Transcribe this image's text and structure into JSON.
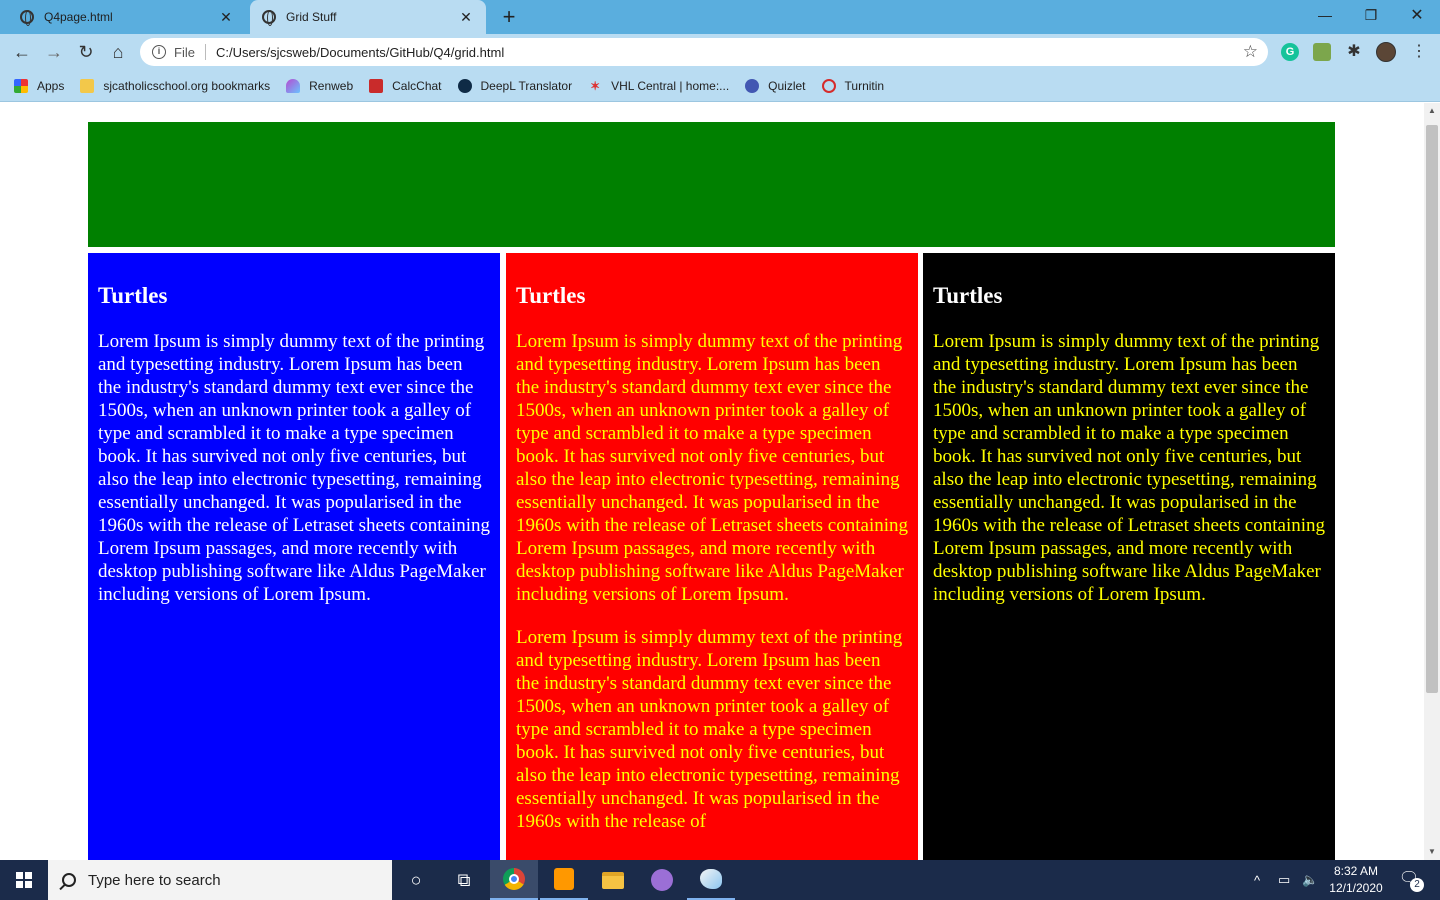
{
  "browser": {
    "tabs": [
      {
        "title": "Q4page.html",
        "close": "✕"
      },
      {
        "title": "Grid Stuff",
        "close": "✕"
      }
    ],
    "new_tab": "+",
    "window_controls": {
      "minimize": "—",
      "maximize": "❐",
      "close": "✕"
    },
    "nav": {
      "back": "←",
      "forward": "→",
      "reload": "↻",
      "home": "⌂"
    },
    "omnibox": {
      "info": "i",
      "scheme": "File",
      "url": "C:/Users/sjcsweb/Documents/GitHub/Q4/grid.html",
      "star": "☆"
    },
    "extensions": {
      "grammarly": "G",
      "puzzle": "✱",
      "menu": "⋮"
    }
  },
  "bookmarks": [
    {
      "label": "Apps",
      "icon": "apps-grid-icon"
    },
    {
      "label": "sjcatholicschool.org bookmarks",
      "icon": "folder-icon"
    },
    {
      "label": "Renweb",
      "icon": "renweb-icon"
    },
    {
      "label": "CalcChat",
      "icon": "calcchat-icon"
    },
    {
      "label": "DeepL Translator",
      "icon": "deepl-icon"
    },
    {
      "label": "VHL Central | home:...",
      "icon": "vhl-icon",
      "glyph": "✶"
    },
    {
      "label": "Quizlet",
      "icon": "quizlet-icon"
    },
    {
      "label": "Turnitin",
      "icon": "turnitin-icon"
    }
  ],
  "page": {
    "colors": {
      "header": "#008000",
      "col1": "#0000ff",
      "col2": "#ff0000",
      "col3": "#000000",
      "yellow_text": "#ffff00"
    },
    "columns": [
      {
        "heading": "Turtles",
        "paragraphs": [
          "Lorem Ipsum is simply dummy text of the printing and typesetting industry. Lorem Ipsum has been the industry's standard dummy text ever since the 1500s, when an unknown printer took a galley of type and scrambled it to make a type specimen book. It has survived not only five centuries, but also the leap into electronic typesetting, remaining essentially unchanged. It was popularised in the 1960s with the release of Letraset sheets containing Lorem Ipsum passages, and more recently with desktop publishing software like Aldus PageMaker including versions of Lorem Ipsum."
        ]
      },
      {
        "heading": "Turtles",
        "paragraphs": [
          "Lorem Ipsum is simply dummy text of the printing and typesetting industry. Lorem Ipsum has been the industry's standard dummy text ever since the 1500s, when an unknown printer took a galley of type and scrambled it to make a type specimen book. It has survived not only five centuries, but also the leap into electronic typesetting, remaining essentially unchanged. It was popularised in the 1960s with the release of Letraset sheets containing Lorem Ipsum passages, and more recently with desktop publishing software like Aldus PageMaker including versions of Lorem Ipsum.",
          "Lorem Ipsum is simply dummy text of the printing and typesetting industry. Lorem Ipsum has been the industry's standard dummy text ever since the 1500s, when an unknown printer took a galley of type and scrambled it to make a type specimen book. It has survived not only five centuries, but also the leap into electronic typesetting, remaining essentially unchanged. It was popularised in the 1960s with the release of"
        ]
      },
      {
        "heading": "Turtles",
        "paragraphs": [
          "Lorem Ipsum is simply dummy text of the printing and typesetting industry. Lorem Ipsum has been the industry's standard dummy text ever since the 1500s, when an unknown printer took a galley of type and scrambled it to make a type specimen book. It has survived not only five centuries, but also the leap into electronic typesetting, remaining essentially unchanged. It was popularised in the 1960s with the release of Letraset sheets containing Lorem Ipsum passages, and more recently with desktop publishing software like Aldus PageMaker including versions of Lorem Ipsum."
        ]
      }
    ]
  },
  "scrollbar": {
    "up": "▲",
    "down": "▼"
  },
  "taskbar": {
    "search_placeholder": "Type here to search",
    "cortana": "○",
    "task_view": "⧉",
    "tray": {
      "chevron": "^",
      "network": "▭",
      "volume": "🔈"
    },
    "time": "8:32 AM",
    "date": "12/1/2020",
    "notifications": "🗨",
    "notification_count": "2"
  }
}
